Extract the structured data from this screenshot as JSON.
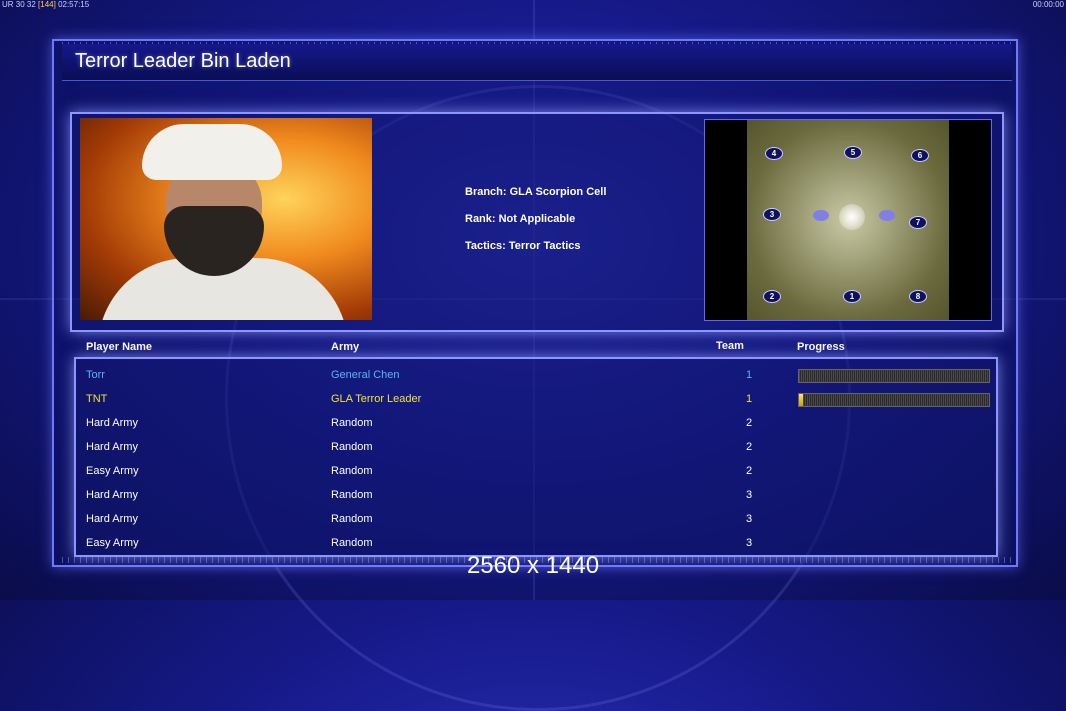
{
  "hud": {
    "top_left": "UR 30 32",
    "fps": "[144]",
    "clock": "02:57:15",
    "top_right": "00:00:00"
  },
  "title": "Terror Leader Bin Laden",
  "info": {
    "branch": "Branch: GLA Scorpion Cell",
    "rank": "Rank: Not Applicable",
    "tactics": "Tactics: Terror Tactics"
  },
  "minimap": {
    "starts": [
      "1",
      "2",
      "3",
      "4",
      "5",
      "6",
      "7",
      "8"
    ]
  },
  "columns": {
    "name": "Player Name",
    "army": "Army",
    "team": "Team",
    "progress": "Progress"
  },
  "players": [
    {
      "name": "Torr",
      "army": "General Chen",
      "team": "1",
      "color": "#5ab4f2",
      "progress": 0.0
    },
    {
      "name": "TNT",
      "army": "GLA Terror Leader",
      "team": "1",
      "color": "#f2e23a",
      "progress": 0.02
    },
    {
      "name": "Hard Army",
      "army": "Random",
      "team": "2",
      "color": "#ffffff"
    },
    {
      "name": "Hard Army",
      "army": "Random",
      "team": "2",
      "color": "#ffffff"
    },
    {
      "name": "Easy Army",
      "army": "Random",
      "team": "2",
      "color": "#ffffff"
    },
    {
      "name": "Hard Army",
      "army": "Random",
      "team": "3",
      "color": "#ffffff"
    },
    {
      "name": "Hard Army",
      "army": "Random",
      "team": "3",
      "color": "#ffffff"
    },
    {
      "name": "Easy Army",
      "army": "Random",
      "team": "3",
      "color": "#ffffff"
    }
  ],
  "resolution": "2560 x 1440"
}
